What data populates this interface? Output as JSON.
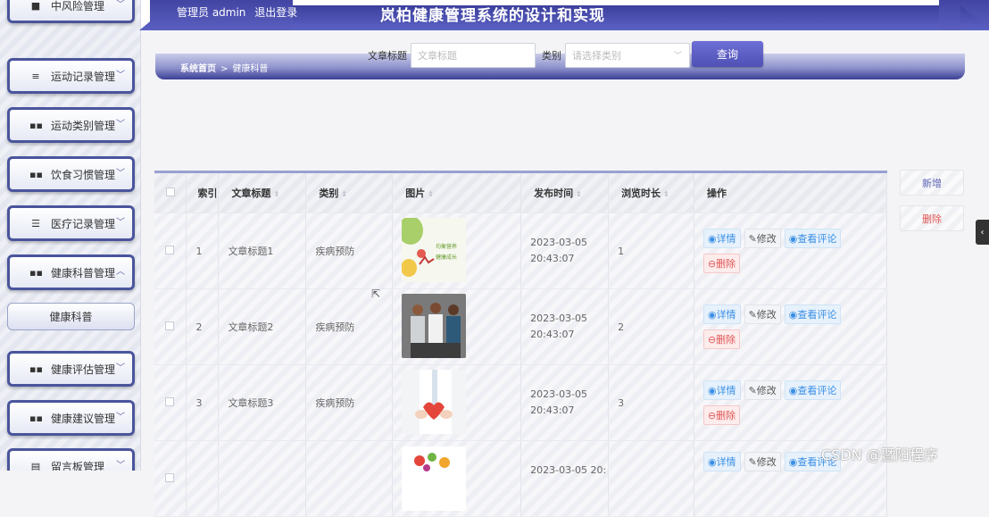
{
  "header": {
    "user_label": "管理员 admin",
    "logout_label": "退出登录",
    "app_title": "岚柏健康管理系统的设计和实现"
  },
  "sidebar": {
    "items": [
      {
        "label": "中风险管理",
        "icon": "grid-icon"
      },
      {
        "label": "运动记录管理",
        "icon": "menu-lines-icon"
      },
      {
        "label": "运动类别管理",
        "icon": "grid-icon"
      },
      {
        "label": "饮食习惯管理",
        "icon": "grid-icon"
      },
      {
        "label": "医疗记录管理",
        "icon": "sliders-icon"
      },
      {
        "label": "健康科普管理",
        "icon": "grid-icon"
      },
      {
        "label": "健康评估管理",
        "icon": "grid-icon"
      },
      {
        "label": "健康建议管理",
        "icon": "grid-icon"
      },
      {
        "label": "留言板管理",
        "icon": "document-icon"
      }
    ],
    "sub_item": "健康科普"
  },
  "search": {
    "title_label": "文章标题",
    "title_placeholder": "文章标题",
    "category_label": "类别",
    "category_placeholder": "请选择类别",
    "button_label": "查询"
  },
  "breadcrumb": {
    "home": "系统首页",
    "separator": ">",
    "current": "健康科普"
  },
  "actions": {
    "add_label": "新增",
    "delete_label": "删除"
  },
  "table": {
    "headers": {
      "select": "",
      "index": "索引",
      "title": "文章标题",
      "category": "类别",
      "image": "图片",
      "publish_time": "发布时间",
      "view_duration": "浏览时长",
      "operations": "操作"
    },
    "rows": [
      {
        "index": "1",
        "title": "文章标题1",
        "category": "疾病预防",
        "publish_time": "2023-03-05 20:43:07",
        "view_duration": "1",
        "image_text": "均衡营养 健康成长"
      },
      {
        "index": "2",
        "title": "文章标题2",
        "category": "疾病预防",
        "publish_time": "2023-03-05 20:43:07",
        "view_duration": "2",
        "image_text": ""
      },
      {
        "index": "3",
        "title": "文章标题3",
        "category": "疾病预防",
        "publish_time": "2023-03-05 20:43:07",
        "view_duration": "3",
        "image_text": ""
      },
      {
        "index": "",
        "title": "",
        "category": "",
        "publish_time": "2023-03-05 20:",
        "view_duration": "",
        "image_text": ""
      }
    ],
    "op_labels": {
      "detail": "详情",
      "edit": "修改",
      "comments": "查看评论",
      "delete": "删除"
    }
  },
  "watermark": "CSDN @暨阳程序",
  "colors": {
    "header_band": "#4a4fb0",
    "menu_border": "#4a559c",
    "op_blue": "#3a8ee6",
    "op_red": "#e05454"
  }
}
